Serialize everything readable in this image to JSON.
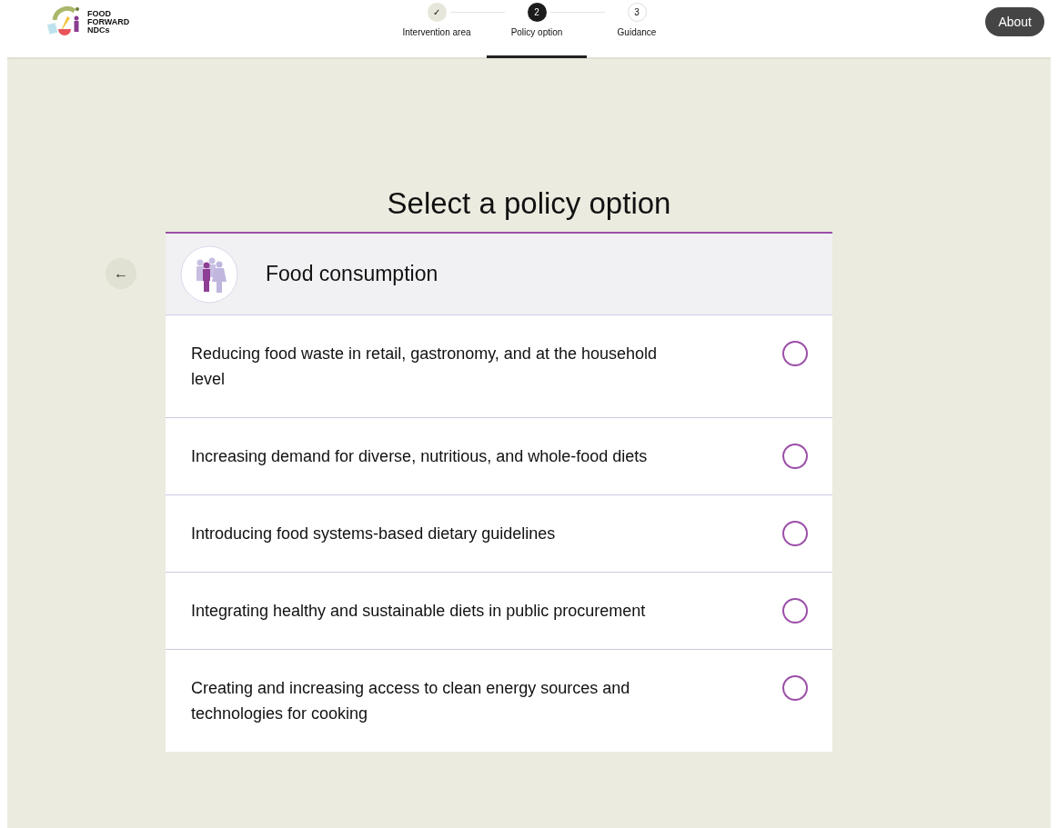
{
  "logo": {
    "lines": [
      "FOOD",
      "FORWARD",
      "NDCs"
    ]
  },
  "steps": [
    {
      "marker": "✓",
      "label": "Intervention area",
      "kind": "done",
      "selected": false
    },
    {
      "marker": "2",
      "label": "Policy option",
      "kind": "current",
      "selected": true
    },
    {
      "marker": "3",
      "label": "Guidance",
      "kind": "upcoming",
      "selected": false
    }
  ],
  "about_button": "About",
  "back_button": "←",
  "title": "Select a policy option",
  "category": {
    "title": "Food consumption"
  },
  "options": [
    {
      "label": "Reducing food waste in retail, gastronomy, and at the household level",
      "selected": false
    },
    {
      "label": "Increasing demand for diverse, nutritious, and whole-food diets",
      "selected": false
    },
    {
      "label": "Introducing food systems-based dietary guidelines",
      "selected": false
    },
    {
      "label": "Integrating healthy and sustainable diets in public procurement",
      "selected": false
    },
    {
      "label": "Creating and increasing access to clean energy sources and technologies for cooking",
      "selected": false
    }
  ]
}
